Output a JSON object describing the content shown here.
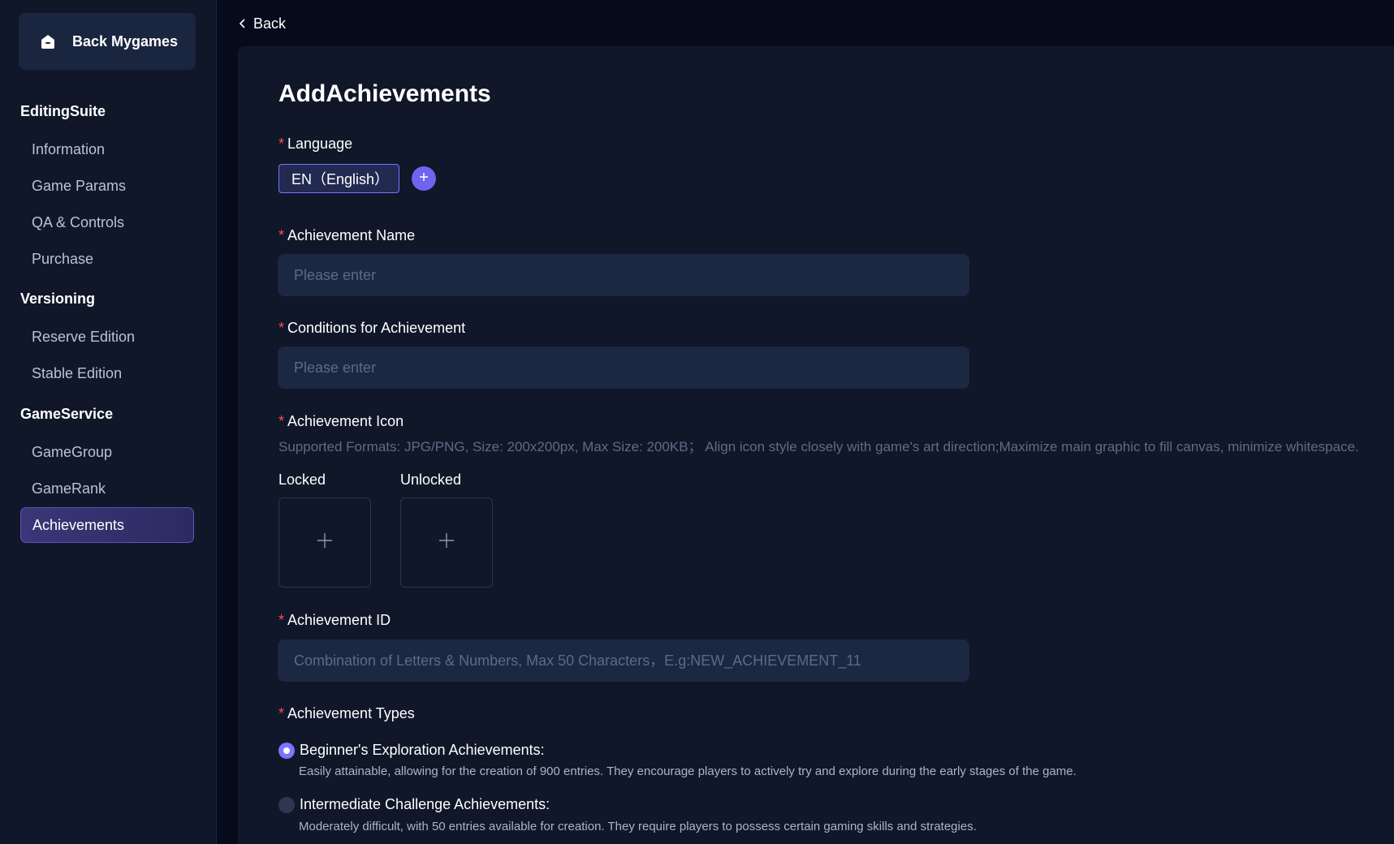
{
  "sidebar": {
    "back_label": "Back Mygames",
    "sections": [
      {
        "title": "EditingSuite",
        "items": [
          "Information",
          "Game Params",
          "QA & Controls",
          "Purchase"
        ]
      },
      {
        "title": "Versioning",
        "items": [
          "Reserve Edition",
          "Stable Edition"
        ]
      },
      {
        "title": "GameService",
        "items": [
          "GameGroup",
          "GameRank",
          "Achievements"
        ]
      }
    ],
    "active_item": "Achievements"
  },
  "header": {
    "back_label": "Back"
  },
  "form": {
    "title": "AddAchievements",
    "required_mark": "*",
    "language": {
      "label": "Language",
      "selected": "EN（English）"
    },
    "name": {
      "label": "Achievement Name",
      "placeholder": "Please enter"
    },
    "conditions": {
      "label": "Conditions for Achievement",
      "placeholder": "Please enter"
    },
    "icon": {
      "label": "Achievement Icon",
      "hint": "Supported Formats: JPG/PNG, Size: 200x200px, Max Size: 200KB；  Align icon style closely with game's art direction;Maximize main graphic to fill canvas, minimize whitespace.",
      "locked_label": "Locked",
      "unlocked_label": "Unlocked"
    },
    "achievement_id": {
      "label": "Achievement ID",
      "placeholder": "Combination of Letters & Numbers, Max 50 Characters，E.g:NEW_ACHIEVEMENT_11"
    },
    "types": {
      "label": "Achievement Types",
      "options": [
        {
          "label": "Beginner's Exploration Achievements:",
          "desc": "Easily attainable, allowing for the creation of 900 entries. They encourage players to actively try and explore during the early stages of the game.",
          "checked": true
        },
        {
          "label": "Intermediate Challenge Achievements:",
          "desc": "Moderately difficult, with 50 entries available for creation. They require players to possess certain gaming skills and strategies.",
          "checked": false
        }
      ]
    }
  },
  "colors": {
    "accent": "#7b74ff",
    "required": "#ff4d4f",
    "panel": "#0f1729",
    "input": "#1c2742"
  }
}
